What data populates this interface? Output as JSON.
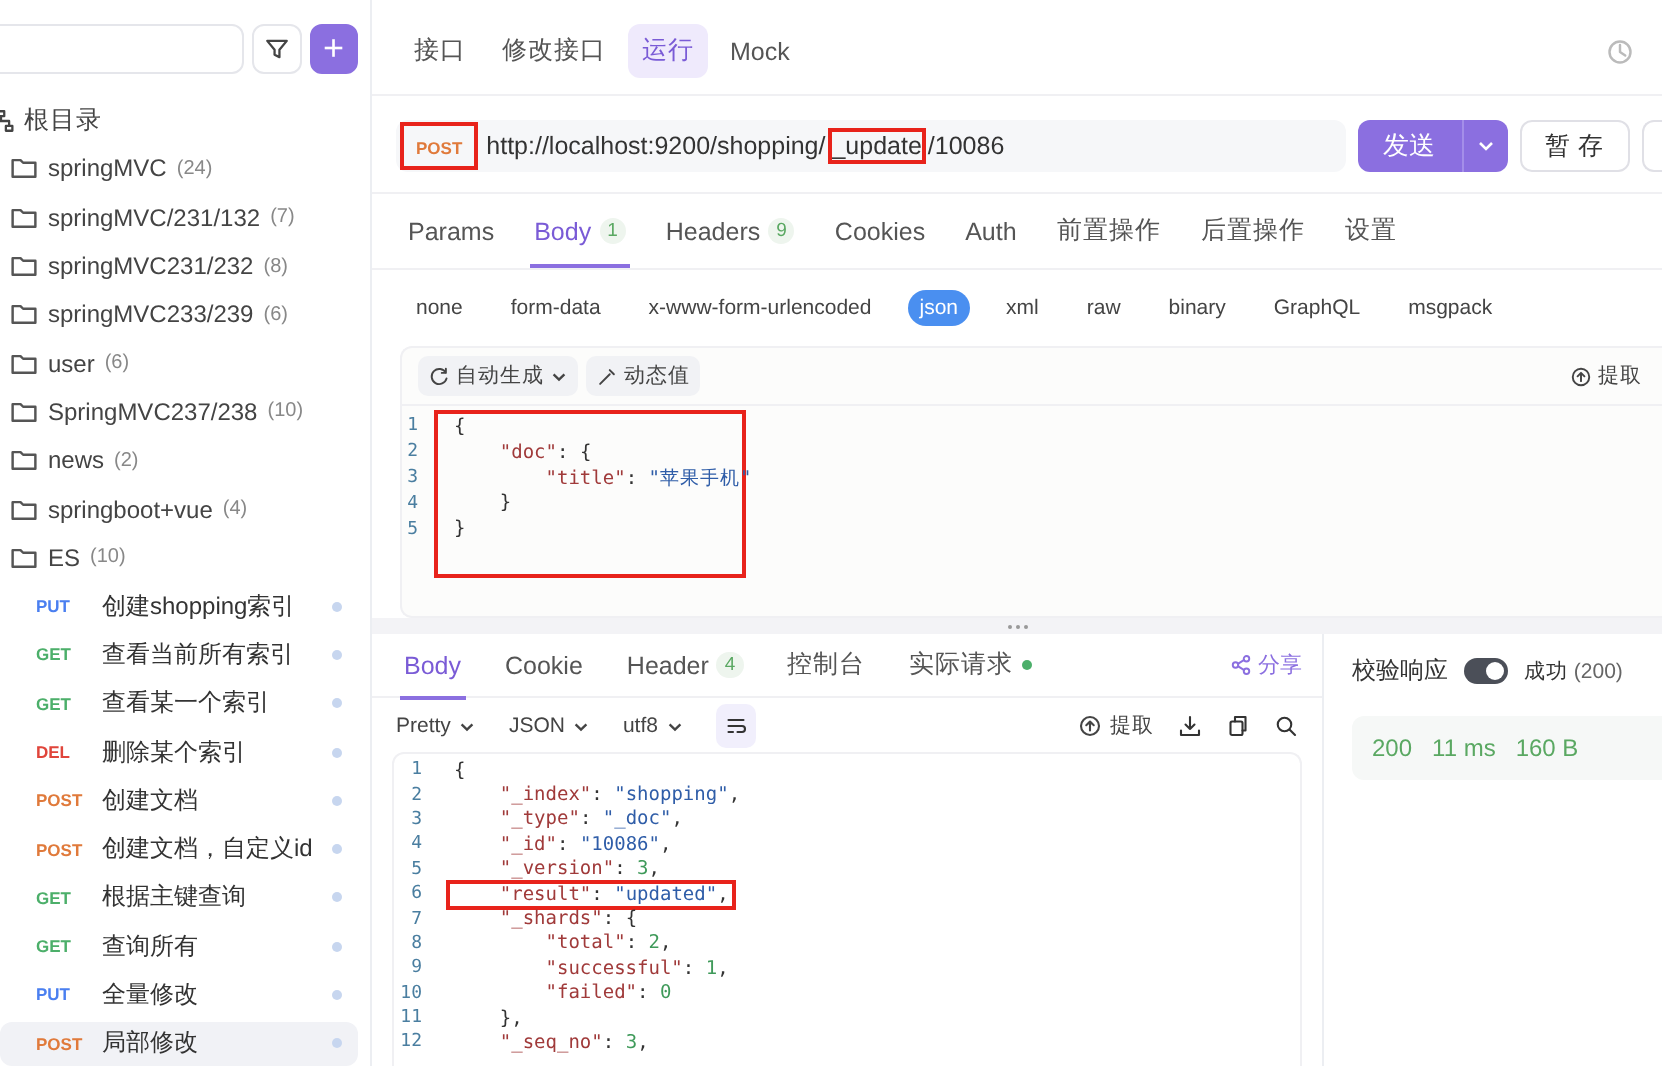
{
  "sidebar": {
    "add_button": "+",
    "tree": {
      "label": "根目录",
      "expanded": true,
      "children": [
        {
          "label": "springMVC",
          "count": "(24)",
          "kind": "folder",
          "expanded": false
        },
        {
          "label": "springMVC/231/132",
          "count": "(7)",
          "kind": "folder",
          "expanded": false
        },
        {
          "label": "springMVC231/232",
          "count": "(8)",
          "kind": "folder",
          "expanded": false
        },
        {
          "label": "springMVC233/239",
          "count": "(6)",
          "kind": "folder",
          "expanded": false
        },
        {
          "label": "user",
          "count": "(6)",
          "kind": "folder",
          "expanded": false
        },
        {
          "label": "SpringMVC237/238",
          "count": "(10)",
          "kind": "folder",
          "expanded": false
        },
        {
          "label": "news",
          "count": "(2)",
          "kind": "folder",
          "expanded": false
        },
        {
          "label": "springboot+vue",
          "count": "(4)",
          "kind": "folder",
          "expanded": false
        },
        {
          "label": "ES",
          "count": "(10)",
          "kind": "folder",
          "expanded": true,
          "children": [
            {
              "kind": "request",
              "method": "PUT",
              "label": "创建shopping索引",
              "selected": false
            },
            {
              "kind": "request",
              "method": "GET",
              "label": "查看当前所有索引",
              "selected": false
            },
            {
              "kind": "request",
              "method": "GET",
              "label": "查看某一个索引",
              "selected": false
            },
            {
              "kind": "request",
              "method": "DEL",
              "label": "删除某个索引",
              "selected": false
            },
            {
              "kind": "request",
              "method": "POST",
              "label": "创建文档",
              "selected": false
            },
            {
              "kind": "request",
              "method": "POST",
              "label": "创建文档，自定义id",
              "selected": false
            },
            {
              "kind": "request",
              "method": "GET",
              "label": "根据主键查询",
              "selected": false
            },
            {
              "kind": "request",
              "method": "GET",
              "label": "查询所有",
              "selected": false
            },
            {
              "kind": "request",
              "method": "PUT",
              "label": "全量修改",
              "selected": false
            },
            {
              "kind": "request",
              "method": "POST",
              "label": "局部修改",
              "selected": true
            }
          ]
        }
      ]
    }
  },
  "top_tabs": [
    {
      "label": "接口",
      "selected": false
    },
    {
      "label": "修改接口",
      "selected": false
    },
    {
      "label": "运行",
      "selected": true
    },
    {
      "label": "Mock",
      "selected": false
    }
  ],
  "request": {
    "method": "POST",
    "method_highlighted": true,
    "url_parts": [
      {
        "text": "http://localhost:9200/shopping/",
        "highlighted": false
      },
      {
        "text": "_update",
        "highlighted": true
      },
      {
        "text": "/10086",
        "highlighted": false
      }
    ],
    "send": "发送",
    "save": "暂 存"
  },
  "param_tabs": [
    {
      "label": "Params",
      "selected": false
    },
    {
      "label": "Body",
      "badge": "1",
      "selected": true
    },
    {
      "label": "Headers",
      "badge": "9",
      "selected": false
    },
    {
      "label": "Cookies",
      "selected": false
    },
    {
      "label": "Auth",
      "selected": false
    },
    {
      "label": "前置操作",
      "selected": false
    },
    {
      "label": "后置操作",
      "selected": false
    },
    {
      "label": "设置",
      "selected": false
    }
  ],
  "body_types": [
    {
      "label": "none",
      "selected": false
    },
    {
      "label": "form-data",
      "selected": false
    },
    {
      "label": "x-www-form-urlencoded",
      "selected": false
    },
    {
      "label": "json",
      "selected": true
    },
    {
      "label": "xml",
      "selected": false
    },
    {
      "label": "raw",
      "selected": false
    },
    {
      "label": "binary",
      "selected": false
    },
    {
      "label": "GraphQL",
      "selected": false
    },
    {
      "label": "msgpack",
      "selected": false
    }
  ],
  "body_editor": {
    "auto_generate": "自动生成",
    "dynamic_value": "动态值",
    "extract": "提取",
    "highlighted": true,
    "lines": [
      {
        "number": "1",
        "text": "{"
      },
      {
        "number": "2",
        "text": "    \"doc\": {"
      },
      {
        "number": "3",
        "text": "        \"title\": \"苹果手机\""
      },
      {
        "number": "4",
        "text": "    }"
      },
      {
        "number": "5",
        "text": "}"
      }
    ]
  },
  "response": {
    "tabs": [
      {
        "label": "Body",
        "selected": true
      },
      {
        "label": "Cookie",
        "selected": false
      },
      {
        "label": "Header",
        "badge": "4",
        "selected": false
      },
      {
        "label": "控制台",
        "selected": false
      },
      {
        "label": "实际请求",
        "dot": true,
        "selected": false
      }
    ],
    "share": "分享",
    "format": "Pretty",
    "type": "JSON",
    "encoding": "utf8",
    "extract": "提取",
    "lines": [
      {
        "number": "1",
        "text": "{",
        "highlighted": false
      },
      {
        "number": "2",
        "text": "    \"_index\": \"shopping\",",
        "highlighted": false
      },
      {
        "number": "3",
        "text": "    \"_type\": \"_doc\",",
        "highlighted": false
      },
      {
        "number": "4",
        "text": "    \"_id\": \"10086\",",
        "highlighted": false
      },
      {
        "number": "5",
        "text": "    \"_version\": 3,",
        "highlighted": false
      },
      {
        "number": "6",
        "text": "    \"result\": \"updated\",",
        "highlighted": true
      },
      {
        "number": "7",
        "text": "    \"_shards\": {",
        "highlighted": false
      },
      {
        "number": "8",
        "text": "        \"total\": 2,",
        "highlighted": false
      },
      {
        "number": "9",
        "text": "        \"successful\": 1,",
        "highlighted": false
      },
      {
        "number": "10",
        "text": "        \"failed\": 0",
        "highlighted": false
      },
      {
        "number": "11",
        "text": "    },",
        "highlighted": false
      },
      {
        "number": "12",
        "text": "    \"_seq_no\": 3,",
        "highlighted": false
      }
    ]
  },
  "validation": {
    "label": "校验响应",
    "on": true,
    "result": "成功",
    "code": "(200)"
  },
  "status": {
    "code": "200",
    "time": "11 ms",
    "size": "160 B"
  }
}
